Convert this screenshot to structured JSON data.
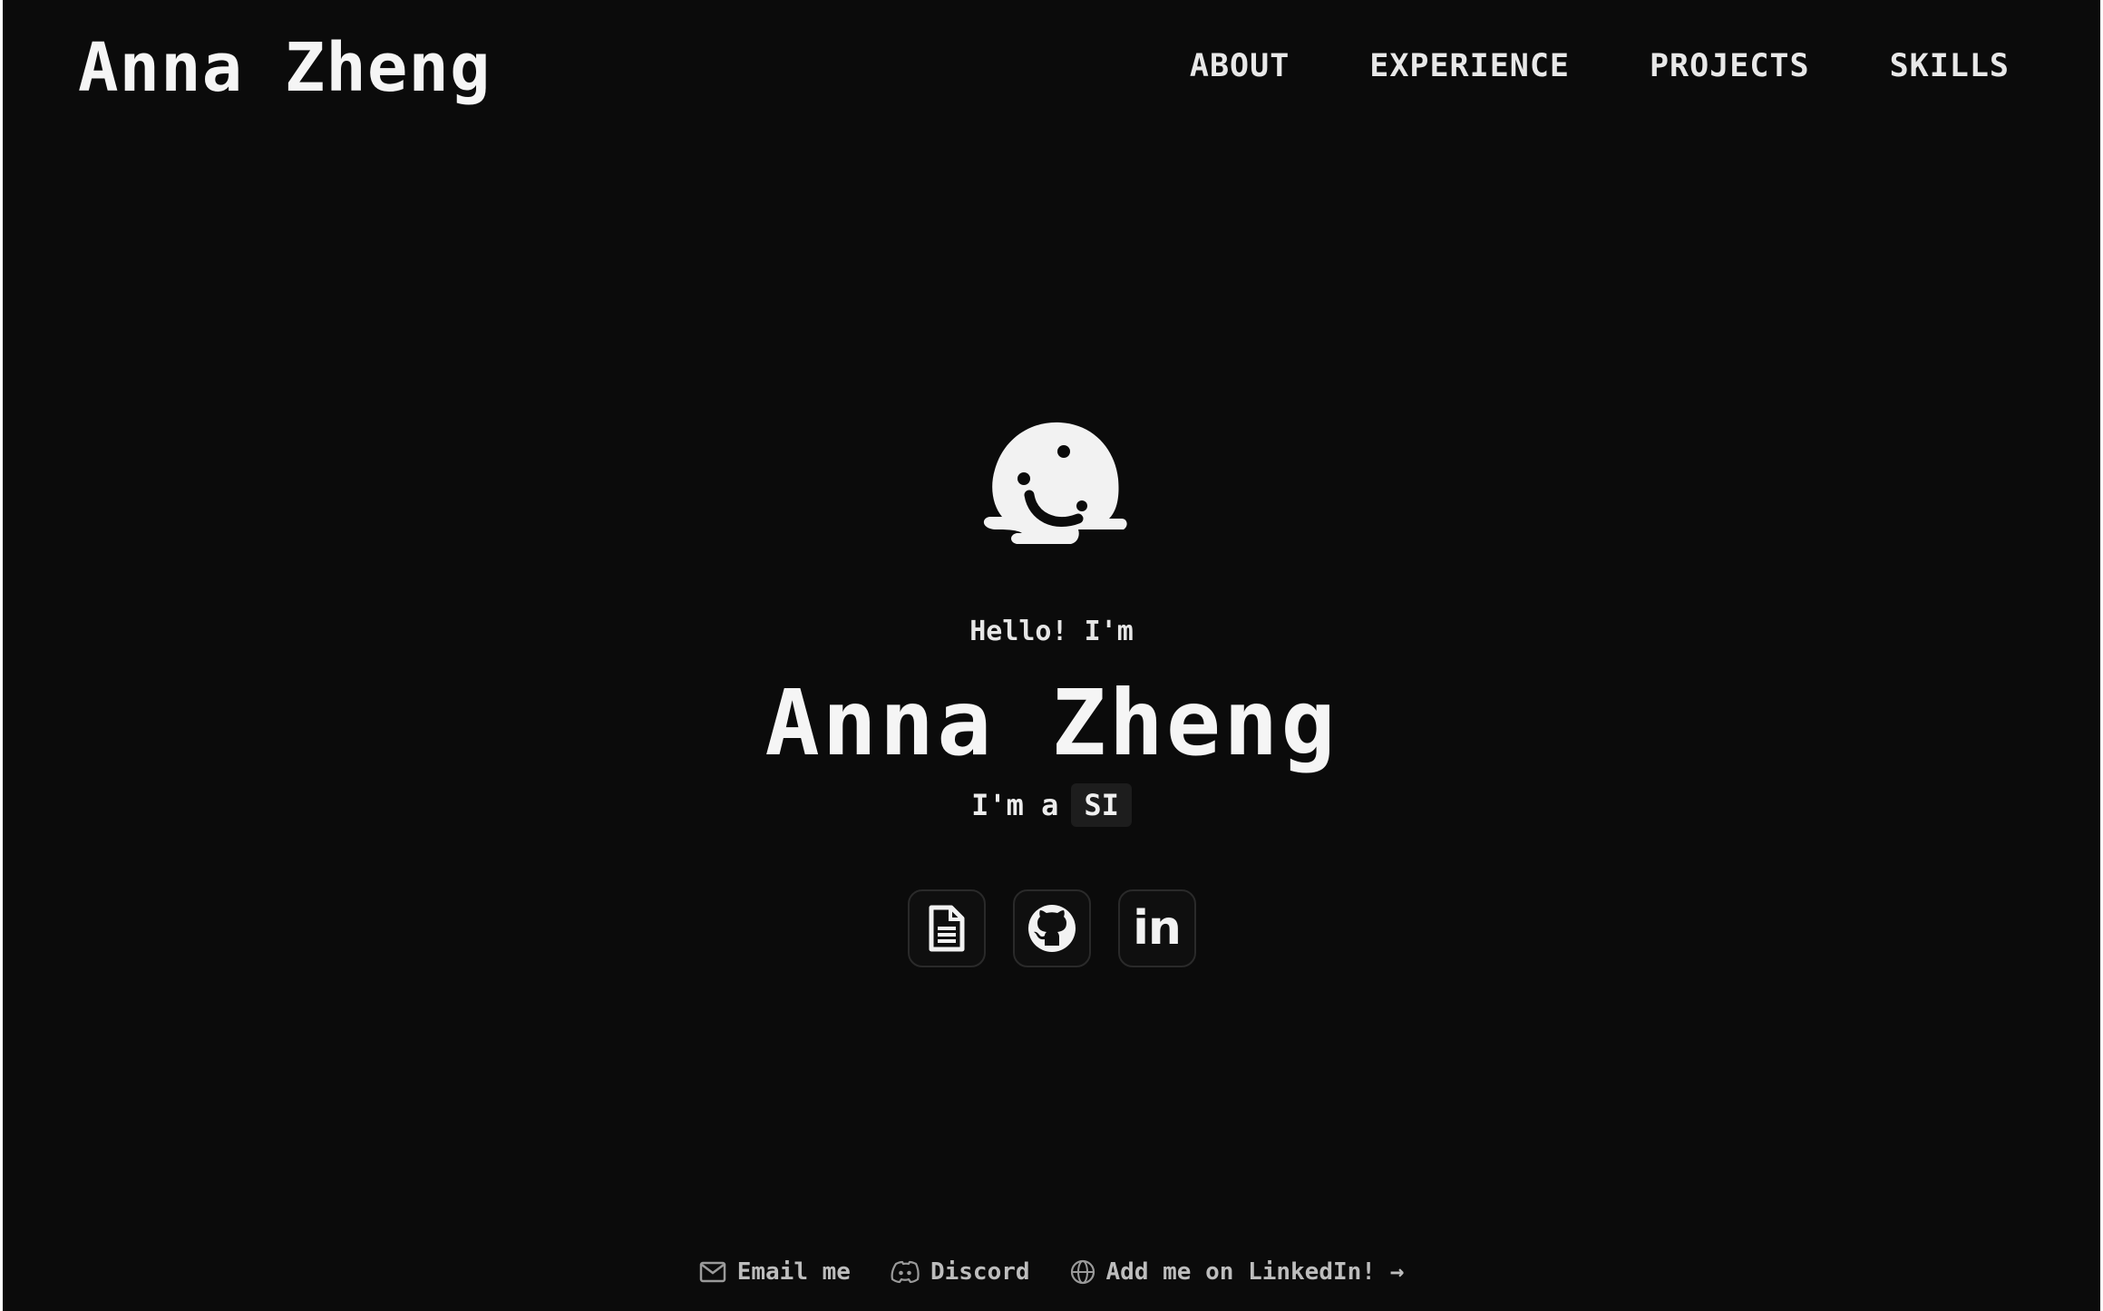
{
  "header": {
    "brand": "Anna Zheng",
    "nav": [
      "ABOUT",
      "EXPERIENCE",
      "PROJECTS",
      "SKILLS"
    ]
  },
  "hero": {
    "avatar_icon": "ghost-avatar-icon",
    "greeting": "Hello! I'm",
    "name": "Anna Zheng",
    "role_prefix": "I'm a",
    "role_tag": "SI"
  },
  "socials": [
    {
      "icon": "document-icon",
      "label": "resume"
    },
    {
      "icon": "github-icon",
      "label": "GitHub"
    },
    {
      "icon": "linkedin-icon",
      "label": "in"
    }
  ],
  "footer": {
    "links": [
      {
        "icon": "mail-icon",
        "label": "Email me"
      },
      {
        "icon": "discord-icon",
        "label": "Discord"
      },
      {
        "icon": "globe-icon",
        "label": "Add me on LinkedIn! →"
      }
    ]
  },
  "colors": {
    "background": "#0b0b0b",
    "text": "#f5f5f5",
    "muted": "#bdbdbd",
    "tag_bg": "#1d1d1d"
  }
}
